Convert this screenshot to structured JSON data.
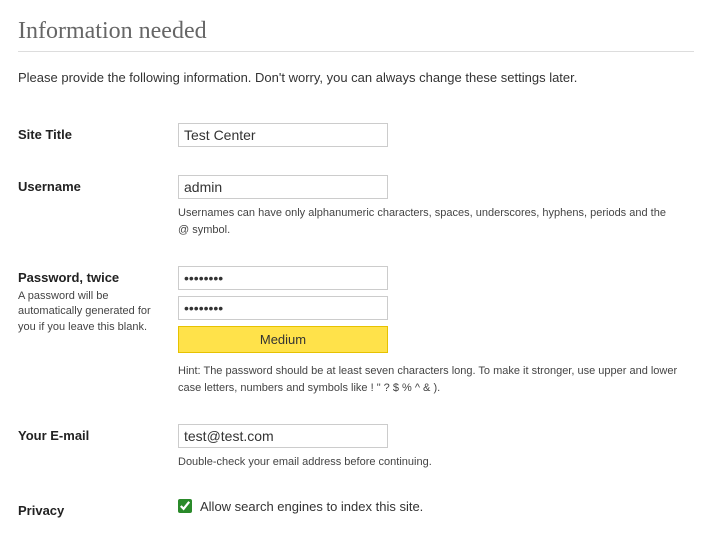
{
  "heading": "Information needed",
  "intro": "Please provide the following information. Don't worry, you can always change these settings later.",
  "fields": {
    "site_title": {
      "label": "Site Title",
      "value": "Test Center"
    },
    "username": {
      "label": "Username",
      "value": "admin",
      "hint": "Usernames can have only alphanumeric characters, spaces, underscores, hyphens, periods and the @ symbol."
    },
    "password": {
      "label": "Password, twice",
      "label_hint": "A password will be automatically generated for you if you leave this blank.",
      "value1": "••••••••",
      "value2": "••••••••",
      "strength": "Medium",
      "hint": "Hint: The password should be at least seven characters long. To make it stronger, use upper and lower case letters, numbers and symbols like ! \" ? $ % ^ & )."
    },
    "email": {
      "label": "Your E-mail",
      "value": "test@test.com",
      "hint": "Double-check your email address before continuing."
    },
    "privacy": {
      "label": "Privacy",
      "checkbox_label": "Allow search engines to index this site."
    }
  }
}
